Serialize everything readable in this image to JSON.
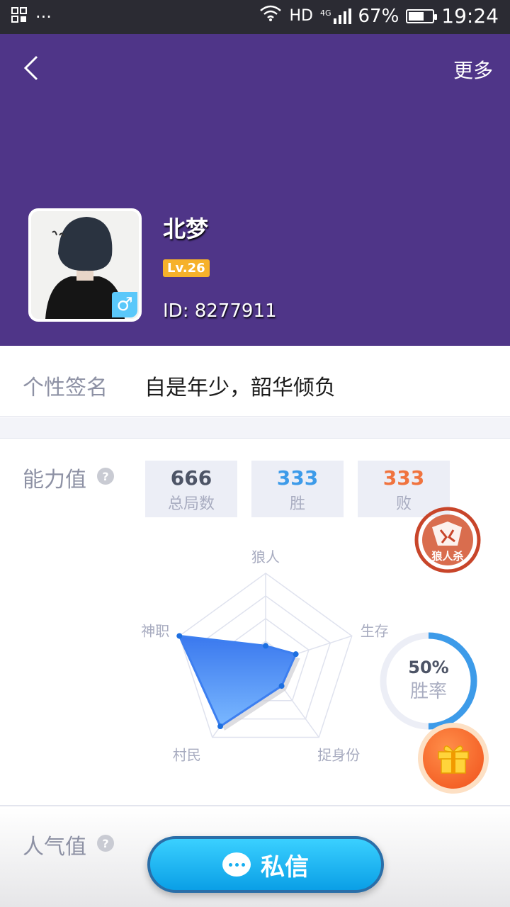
{
  "status_bar": {
    "network": "HD",
    "signal": "4G",
    "battery": "67%",
    "battery_level": 0.67,
    "time": "19:24"
  },
  "header": {
    "more_label": "更多",
    "nickname": "北梦",
    "level": "Lv.26",
    "user_id": "ID: 8277911",
    "gender_symbol": "♂",
    "background_color": "#4f3588"
  },
  "signature": {
    "label": "个性签名",
    "value": "自是年少，韶华倾负"
  },
  "ability": {
    "label": "能力值",
    "help": "?",
    "stats": [
      {
        "value": "666",
        "label": "总局数",
        "color": "#4d5466"
      },
      {
        "value": "333",
        "label": "胜",
        "color": "#3d9be9"
      },
      {
        "value": "333",
        "label": "败",
        "color": "#f0733e"
      }
    ],
    "radar": {
      "axes": [
        "狼人",
        "生存",
        "捉身份",
        "村民",
        "神职"
      ],
      "values": [
        0.2,
        0.35,
        0.3,
        0.85,
        1.0
      ],
      "fill_color": "#3d7ff0"
    },
    "stamp_text": "狼人杀",
    "win_rate": {
      "value": "50%",
      "label": "胜率",
      "fraction": 0.5
    }
  },
  "popularity": {
    "label": "人气值",
    "help": "?"
  },
  "private_message_button": "私信"
}
